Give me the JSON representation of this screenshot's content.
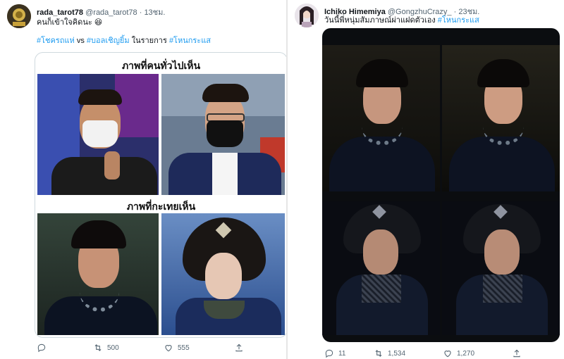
{
  "tweet_left": {
    "display_name": "rada_tarot78",
    "handle": "@rada_tarot78",
    "time": "· 13ชม.",
    "text_line1": "คนก็เข้าใจคิดนะ 😆",
    "hashtag1": "#โชครถแห่",
    "vs": "vs",
    "hashtag2": "#บอลเชิญยิ้ม",
    "mid_text": "ในรายการ",
    "hashtag3": "#โหนกระแส",
    "caption_top": "ภาพที่คนทั่วไปเห็น",
    "caption_bottom": "ภาพที่กะเทยเห็น",
    "replies": "",
    "retweets": "500",
    "likes": "555"
  },
  "tweet_right": {
    "display_name": "Ichiko Himemiya",
    "handle": "@GongzhuCrazy_",
    "time": "· 23ชม.",
    "text": "วันนี้พี่หนุ่มสัมภาษณ์ผ่าแฝดตัวเอง",
    "hashtag": "#โหนกระแส",
    "replies": "11",
    "retweets": "1,534",
    "likes": "1,270"
  },
  "icons": [
    "reply-icon",
    "retweet-icon",
    "like-icon",
    "share-icon"
  ],
  "colors": {
    "accent": "#1d9bf0",
    "meta": "#536471"
  }
}
